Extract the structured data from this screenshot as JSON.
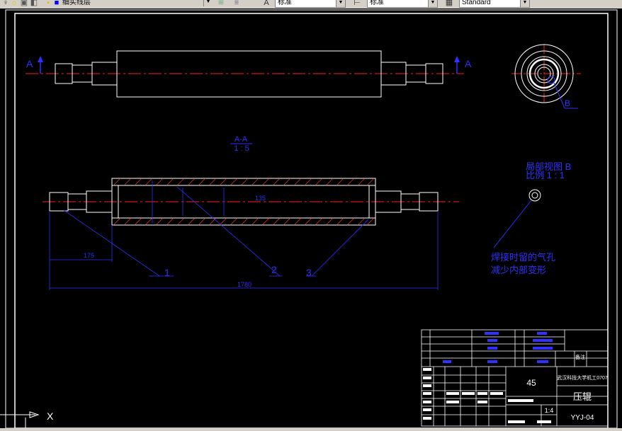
{
  "toolbar": {
    "layer_name": "细实线层",
    "text_style": "标准",
    "dim_style": "标准",
    "table_style": "Standard"
  },
  "drawing": {
    "section_label_left": "A",
    "section_label_right": "A",
    "detail_label": "B",
    "section_title": "A-A",
    "section_scale": "1 : 5",
    "detail_title": "局部视图 B",
    "detail_scale": "比例 1 : 1",
    "note_line1": "焊接时留的气孔",
    "note_line2": "减少内部变形",
    "dim_135": "135",
    "dim_175": "175",
    "dim_1780": "1780",
    "balloon_1": "1",
    "balloon_2": "2",
    "balloon_3": "3"
  },
  "title_block": {
    "material": "45",
    "school": "武汉科技大学机工0707",
    "part_name": "压辊",
    "scale": "1:4",
    "drawing_no": "YYJ-04",
    "remark": "备注"
  },
  "ucs": {
    "x_label": "X"
  }
}
